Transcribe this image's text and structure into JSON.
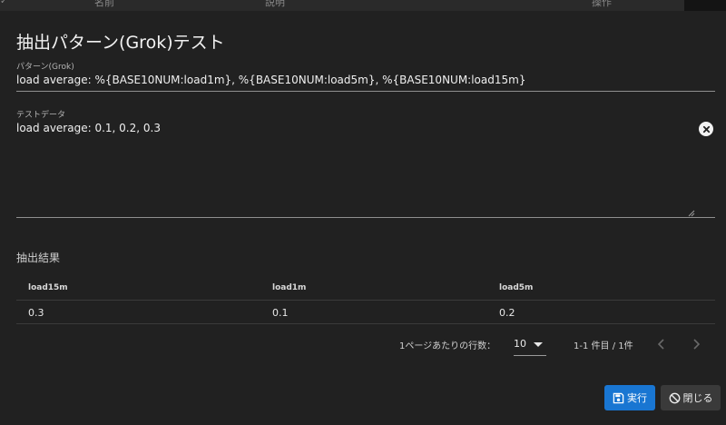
{
  "background": {
    "columns": [
      "名前",
      "説明",
      "操作"
    ]
  },
  "dialog": {
    "title": "抽出パターン(Grok)テスト",
    "pattern": {
      "label": "パターン(Grok)",
      "value": "load average: %{BASE10NUM:load1m}, %{BASE10NUM:load5m}, %{BASE10NUM:load15m}"
    },
    "test_data": {
      "label": "テストデータ",
      "value": "load average: 0.1, 0.2, 0.3"
    },
    "result": {
      "label": "抽出結果",
      "columns": [
        "load15m",
        "load1m",
        "load5m"
      ],
      "rows": [
        [
          "0.3",
          "0.1",
          "0.2"
        ]
      ]
    },
    "pagination": {
      "rows_per_page_label": "1ページあたりの行数：",
      "rows_per_page": "10",
      "range": "1-1 件目 / 1件"
    },
    "actions": {
      "run": "実行",
      "close": "閉じる"
    }
  },
  "icons": {
    "clear": "clear-circle-icon",
    "save": "floppy-disk-icon",
    "cancel": "block-icon",
    "prev": "chevron-left-icon",
    "next": "chevron-right-icon"
  },
  "colors": {
    "primary": "#1976d2",
    "surface": "#212121",
    "text": "#e8e8e8"
  }
}
